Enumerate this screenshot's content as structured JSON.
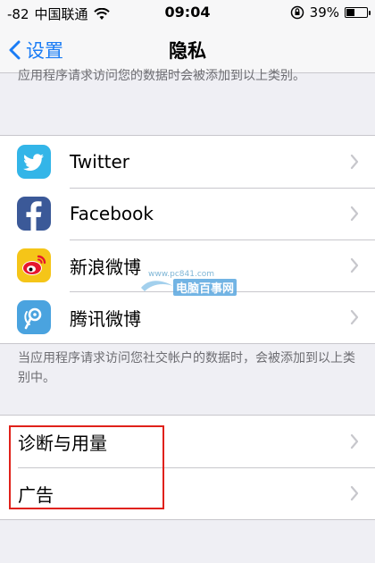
{
  "status_bar": {
    "signal": "-82",
    "carrier": "中国联通",
    "time": "09:04",
    "battery": "39%",
    "battery_level": 0.39
  },
  "nav": {
    "back_label": "设置",
    "title": "隐私"
  },
  "top_footer": "应用程序请求访问您的数据时会被添加到以上类别。",
  "social": {
    "items": [
      {
        "label": "Twitter"
      },
      {
        "label": "Facebook"
      },
      {
        "label": "新浪微博"
      },
      {
        "label": "腾讯微博"
      }
    ],
    "footer": "当应用程序请求访问您社交帐户的数据时，会被添加到以上类别中。"
  },
  "system": {
    "items": [
      {
        "label": "诊断与用量"
      },
      {
        "label": "广告"
      }
    ]
  },
  "watermark": {
    "url": "www.pc841.com",
    "name": "电脑百事网"
  },
  "colors": {
    "accent": "#1a7cf5",
    "twitter": "#33b5e8",
    "facebook": "#3b5998",
    "weibo": "#f5c518",
    "tencent": "#4aa3df",
    "highlight": "#e0211a"
  }
}
